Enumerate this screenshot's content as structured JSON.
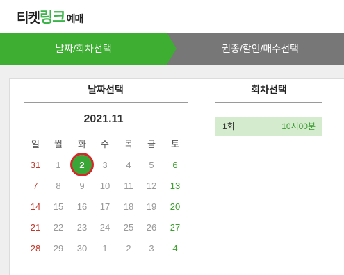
{
  "header": {
    "logo_part1": "티켓",
    "logo_part2": "링크",
    "logo_part3": "예매"
  },
  "steps": [
    {
      "label": "날짜/회차선택",
      "active": true
    },
    {
      "label": "권종/할인/매수선택",
      "active": false
    }
  ],
  "date_section": {
    "title": "날짜선택",
    "month": "2021.11",
    "weekdays": [
      "일",
      "월",
      "화",
      "수",
      "목",
      "금",
      "토"
    ],
    "weeks": [
      [
        "31",
        "1",
        "2",
        "3",
        "4",
        "5",
        "6"
      ],
      [
        "7",
        "8",
        "9",
        "10",
        "11",
        "12",
        "13"
      ],
      [
        "14",
        "15",
        "16",
        "17",
        "18",
        "19",
        "20"
      ],
      [
        "21",
        "22",
        "23",
        "24",
        "25",
        "26",
        "27"
      ],
      [
        "28",
        "29",
        "30",
        "1",
        "2",
        "3",
        "4"
      ]
    ],
    "selected_day": "2"
  },
  "session_section": {
    "title": "회차선택",
    "sessions": [
      {
        "number": "1회",
        "time": "10시00분"
      }
    ]
  },
  "colors": {
    "accent_green": "#3dae32",
    "step_inactive": "#777777",
    "selected_ring": "#d22a2a",
    "sunday": "#c0392b",
    "saturday": "#3aa02c",
    "session_bg": "#d4ebcd"
  }
}
